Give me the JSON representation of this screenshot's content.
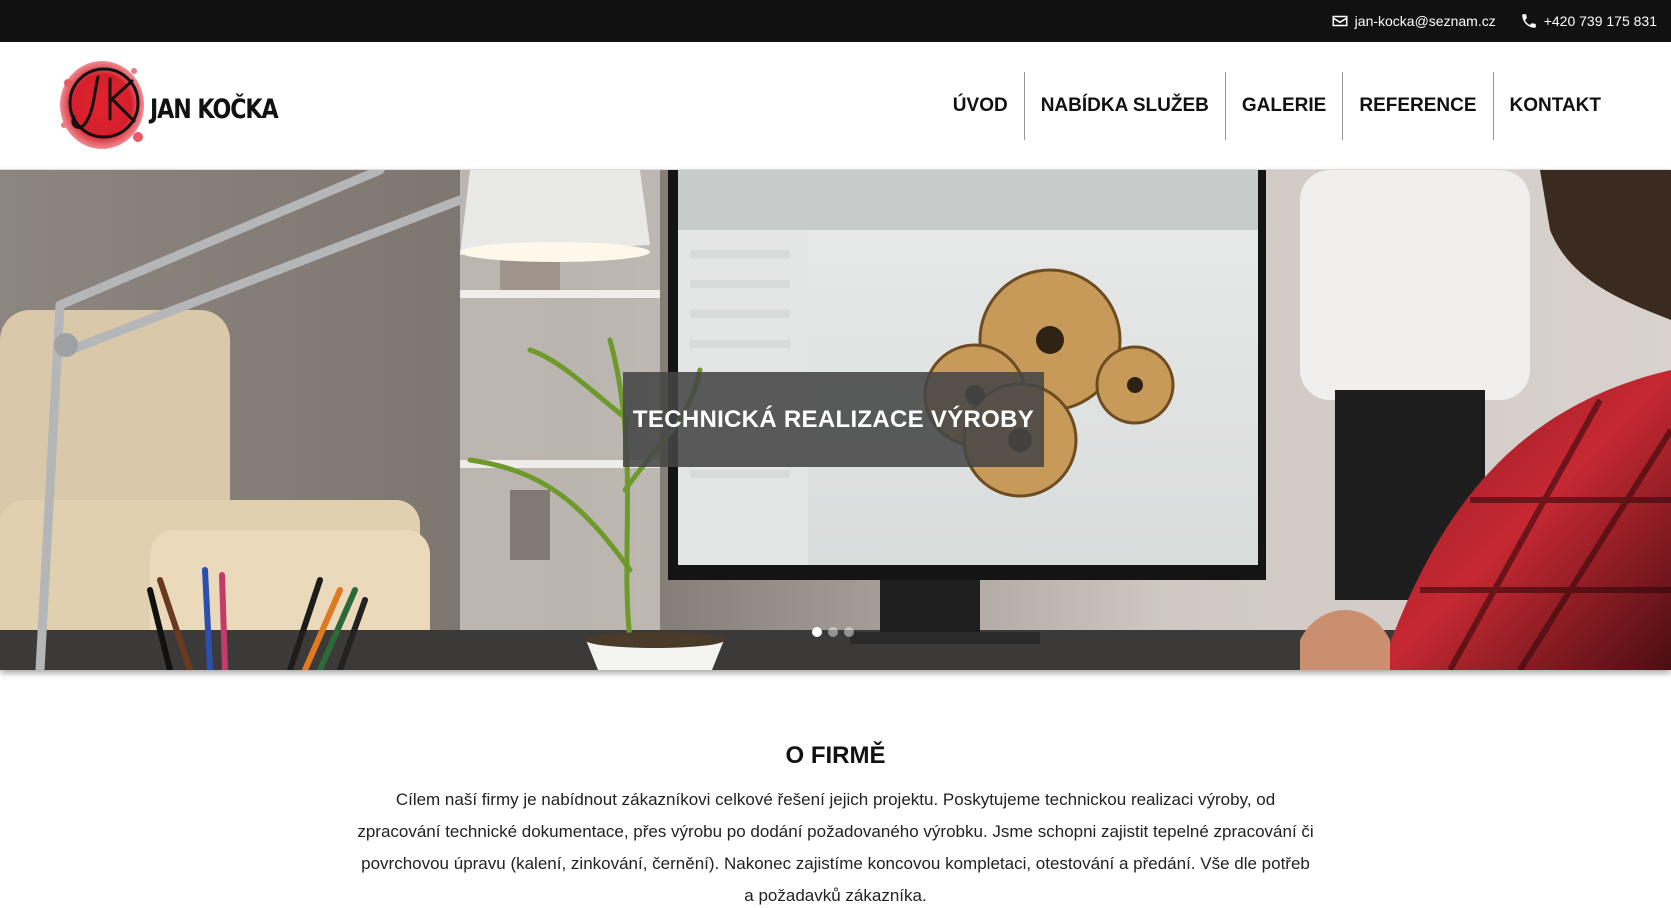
{
  "topbar": {
    "email": "jan-kocka@seznam.cz",
    "email_icon": "mail-icon",
    "phone": "+420 739 175 831",
    "phone_icon": "phone-icon"
  },
  "header": {
    "logo_text": "JAN KOČKA",
    "logo_monogram": "JK",
    "nav": [
      {
        "label": "ÚVOD"
      },
      {
        "label": "NABÍDKA SLUŽEB"
      },
      {
        "label": "GALERIE"
      },
      {
        "label": "REFERENCE"
      },
      {
        "label": "KONTAKT"
      }
    ]
  },
  "hero": {
    "caption": "TECHNICKÁ REALIZACE VÝROBY",
    "slides_count": 3,
    "active_slide": 1
  },
  "about": {
    "title": "O FIRMĚ",
    "text": "Cílem naší firmy je nabídnout zákazníkovi celkové řešení jejich projektu. Poskytujeme technickou realizaci výroby, od zpracování technické dokumentace, přes výrobu po dodání požadovaného výrobku. Jsme schopni zajistit tepelné zpracování či povrchovou úpravu (kalení, zinkování, černění). Nakonec zajistíme koncovou kompletaci, otestování a předání. Vše dle potřeb a požadavků zákazníka."
  },
  "colors": {
    "topbar_bg": "#111111",
    "logo_accent": "#d61f2c",
    "caption_bg": "#464646"
  }
}
